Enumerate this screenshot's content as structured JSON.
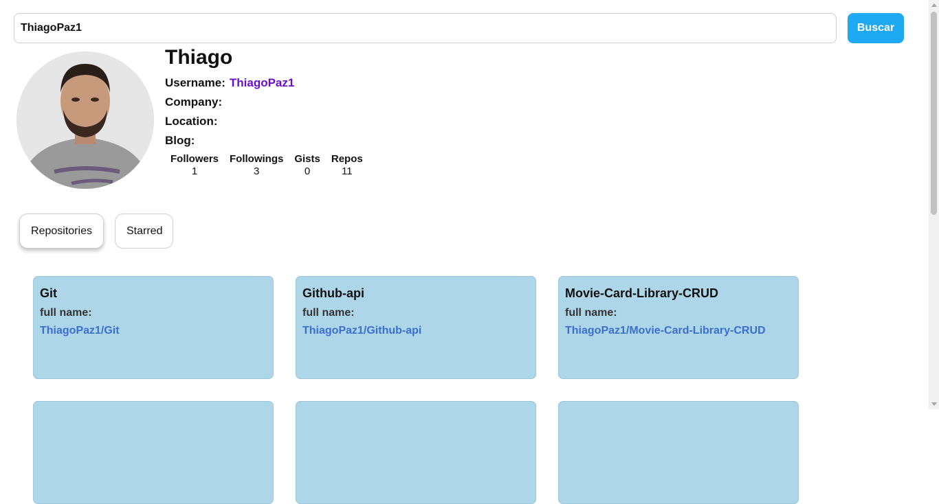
{
  "search": {
    "value": "ThiagoPaz1",
    "button_label": "Buscar"
  },
  "profile": {
    "name": "Thiago",
    "username_label": "Username:",
    "username": "ThiagoPaz1",
    "company_label": "Company:",
    "company": "",
    "location_label": "Location:",
    "location": "",
    "blog_label": "Blog:",
    "blog": "",
    "stats": [
      {
        "label": "Followers",
        "value": "1"
      },
      {
        "label": "Followings",
        "value": "3"
      },
      {
        "label": "Gists",
        "value": "0"
      },
      {
        "label": "Repos",
        "value": "11"
      }
    ]
  },
  "tabs": [
    {
      "label": "Repositories",
      "active": true
    },
    {
      "label": "Starred",
      "active": false
    }
  ],
  "repos": [
    {
      "name": "Git",
      "full_name_label": "full name:",
      "full_name": "ThiagoPaz1/Git"
    },
    {
      "name": "Github-api",
      "full_name_label": "full name:",
      "full_name": "ThiagoPaz1/Github-api"
    },
    {
      "name": "Movie-Card-Library-CRUD",
      "full_name_label": "full name:",
      "full_name": "ThiagoPaz1/Movie-Card-Library-CRUD"
    }
  ],
  "colors": {
    "accent": "#1fa9f3",
    "username": "#6a0dce",
    "card_bg": "#add6e9",
    "link": "#3a6fd0"
  }
}
